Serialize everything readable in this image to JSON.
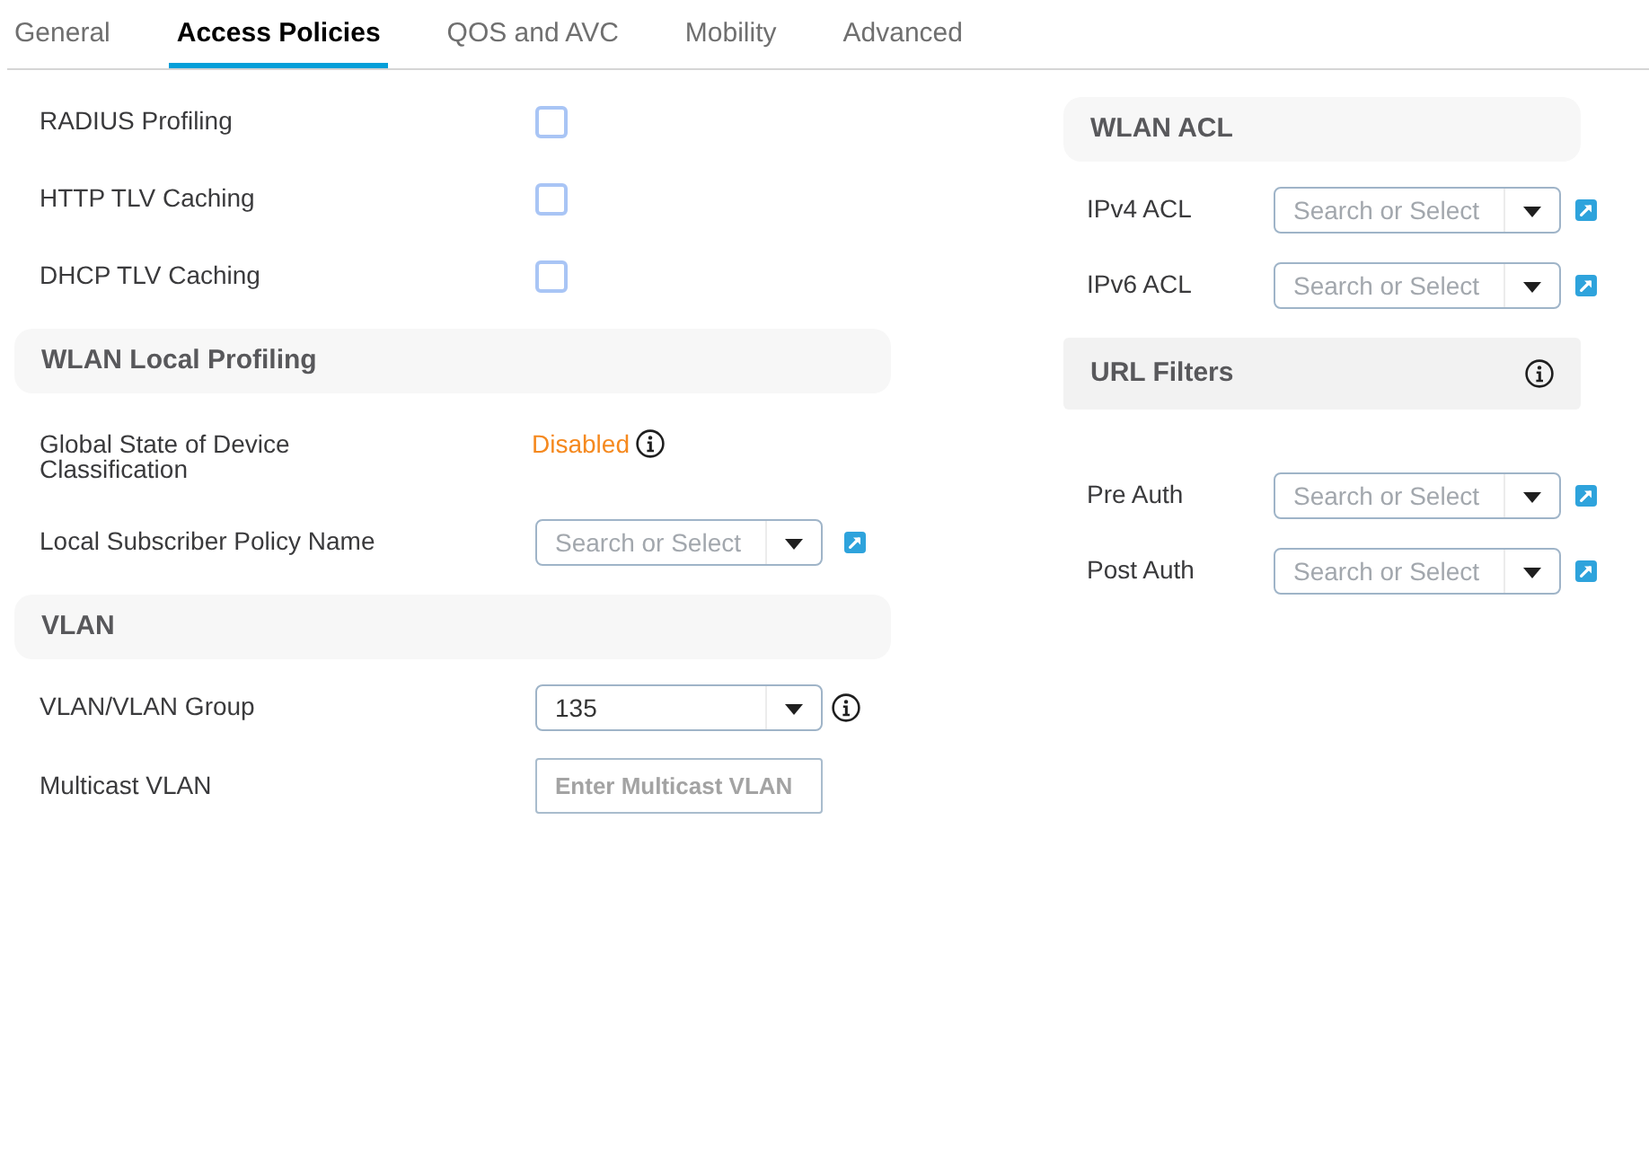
{
  "tabs": [
    {
      "label": "General",
      "selected": false
    },
    {
      "label": "Access Policies",
      "selected": true
    },
    {
      "label": "QOS and AVC",
      "selected": false
    },
    {
      "label": "Mobility",
      "selected": false
    },
    {
      "label": "Advanced",
      "selected": false
    }
  ],
  "left_column": [
    {
      "kind": "checkbox",
      "label": "RADIUS Profiling",
      "checked": false
    },
    {
      "kind": "checkbox",
      "label": "HTTP TLV Caching",
      "checked": false
    },
    {
      "kind": "checkbox",
      "label": "DHCP TLV Caching",
      "checked": false
    },
    {
      "kind": "header",
      "title": "WLAN Local Profiling"
    },
    {
      "kind": "status",
      "label": "Global State of Device Classification",
      "value": "Disabled",
      "enabled": false,
      "info": true
    },
    {
      "kind": "select",
      "label": "Local Subscriber Policy Name",
      "placeholder": "Search or Select",
      "link": true
    },
    {
      "kind": "header",
      "title": "VLAN"
    },
    {
      "kind": "select",
      "label": "VLAN/VLAN Group",
      "value": "135",
      "info": true
    },
    {
      "kind": "input",
      "label": "Multicast VLAN",
      "placeholder": "Enter Multicast VLAN"
    }
  ],
  "right_column": [
    {
      "kind": "header",
      "title": "WLAN ACL"
    },
    {
      "kind": "select",
      "label": "IPv4 ACL",
      "placeholder": "Search or Select",
      "link": true
    },
    {
      "kind": "select",
      "label": "IPv6 ACL",
      "placeholder": "Search or Select",
      "link": true
    },
    {
      "kind": "header",
      "title": "URL Filters",
      "info": true
    },
    {
      "kind": "select",
      "label": "Pre Auth",
      "placeholder": "Search or Select",
      "link": true
    },
    {
      "kind": "select",
      "label": "Post Auth",
      "placeholder": "Search or Select",
      "link": true
    }
  ]
}
